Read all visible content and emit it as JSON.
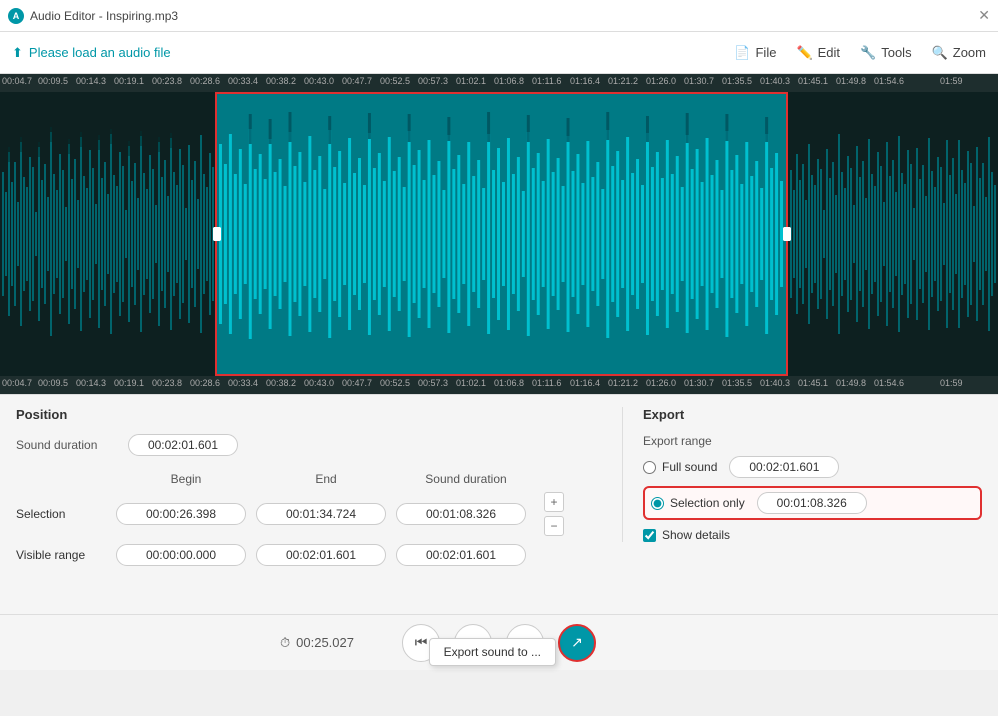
{
  "titlebar": {
    "icon": "A",
    "title": "Audio Editor - Inspiring.mp3",
    "close_label": "✕"
  },
  "toolbar": {
    "load_label": "Please load an audio file",
    "load_icon": "⬆",
    "menus": [
      {
        "id": "file",
        "icon": "📄",
        "label": "File"
      },
      {
        "id": "edit",
        "icon": "✏️",
        "label": "Edit"
      },
      {
        "id": "tools",
        "icon": "🔧",
        "label": "Tools"
      },
      {
        "id": "zoom",
        "icon": "🔍",
        "label": "Zoom"
      }
    ]
  },
  "ruler": {
    "labels": [
      "00:04.7",
      "00:09.5",
      "00:14.3",
      "00:19.1",
      "00:23.8",
      "00:28.6",
      "00:33.4",
      "00:38.2",
      "00:43.0",
      "00:47.7",
      "00:52.5",
      "00:57.3",
      "01:02.1",
      "01:06.8",
      "01:11.6",
      "01:16.4",
      "01:21.2",
      "01:26.0",
      "01:30.7",
      "01:35.5",
      "01:40.3",
      "01:45.1",
      "01:49.8",
      "01:54.6",
      "01:59"
    ]
  },
  "position_section": {
    "title": "Position",
    "sound_duration_label": "Sound duration",
    "sound_duration_value": "00:02:01.601"
  },
  "table": {
    "headers": [
      "Begin",
      "End",
      "Sound duration"
    ],
    "rows": [
      {
        "label": "Selection",
        "begin": "00:00:26.398",
        "end": "00:01:34.724",
        "sound_duration": "00:01:08.326"
      },
      {
        "label": "Visible range",
        "begin": "00:00:00.000",
        "end": "00:02:01.601",
        "sound_duration": "00:02:01.601"
      }
    ]
  },
  "export_section": {
    "title": "Export",
    "range_label": "Export range",
    "full_sound_label": "Full sound",
    "full_sound_value": "00:02:01.601",
    "selection_only_label": "Selection only",
    "selection_only_value": "00:01:08.326",
    "show_details_label": "Show details"
  },
  "transport": {
    "time_icon": "⏱",
    "time_value": "00:25.027",
    "skip_back_icon": "⏮",
    "pause_icon": "⏸",
    "stop_icon": "⏹",
    "export_icon": "↗",
    "tooltip": "Export sound to ..."
  }
}
